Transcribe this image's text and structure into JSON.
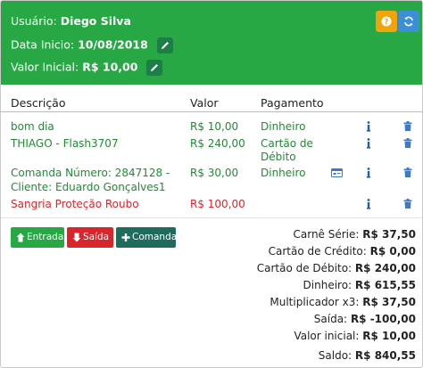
{
  "header": {
    "user_label": "Usuário:",
    "user_name": "Diego Silva",
    "date_label": "Data Inicio:",
    "date_value": "10/08/2018",
    "initial_label": "Valor Inicial:",
    "initial_value": "R$ 10,00",
    "help_icon": "question-icon",
    "refresh_icon": "refresh-icon"
  },
  "table": {
    "columns": [
      "Descrição",
      "Valor",
      "Pagamento"
    ],
    "rows": [
      {
        "desc": "bom dia",
        "valor": "R$ 10,00",
        "pag": "Dinheiro",
        "color": "#1f8c33"
      },
      {
        "desc": "THIAGO - Flash3707",
        "valor": "R$ 240,00",
        "pag_line1": "Cartão de",
        "pag_line2": "Débito",
        "color": "#1f8c33"
      },
      {
        "desc_line1": "Comanda Número: 2847128 -",
        "desc_line2": "Cliente: Eduardo Gonçalves1",
        "valor": "R$ 30,00",
        "pag": "Dinheiro",
        "color": "#1f8c33"
      },
      {
        "desc": "Sangria Proteção Roubo",
        "valor": "R$ 100,00",
        "pag": "",
        "color": "#d9262b"
      }
    ]
  },
  "buttons": {
    "entrada": "Entrada",
    "saida": "Saída",
    "comanda": "Comanda"
  },
  "summary": [
    {
      "label": "Carnê Série:",
      "value": "R$ 37,50"
    },
    {
      "label": "Cartão de Crédito:",
      "value": "R$ 0,00"
    },
    {
      "label": "Cartão de Débito:",
      "value": "R$ 240,00"
    },
    {
      "label": "Dinheiro:",
      "value": "R$ 615,55"
    },
    {
      "label": "Multiplicador x3:",
      "value": "R$ 37,50"
    },
    {
      "label": "Saída:",
      "value": "R$ -100,00"
    },
    {
      "label": "Valor inicial:",
      "value": "R$ 10,00"
    },
    {
      "label": "Saldo:",
      "value": "R$ 840,55"
    }
  ],
  "colors": {
    "header_bg": "#28a745",
    "income": "#1f8c33",
    "expense": "#d9262b",
    "help_btn": "#f0a30a",
    "refresh_btn": "#3b8fd6"
  }
}
